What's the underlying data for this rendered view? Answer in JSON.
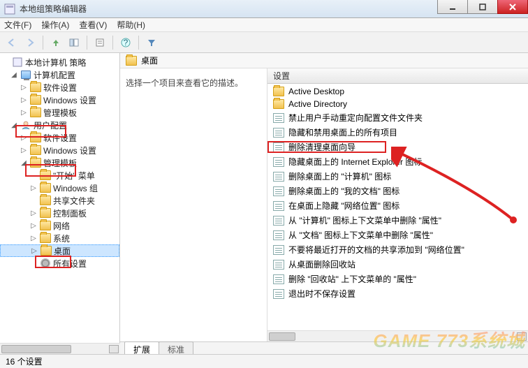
{
  "window": {
    "title": "本地组策略编辑器",
    "menus": [
      "文件(F)",
      "操作(A)",
      "查看(V)",
      "帮助(H)"
    ]
  },
  "tree": {
    "root": "本地计算机 策略",
    "computer": "计算机配置",
    "comp_children": [
      "软件设置",
      "Windows 设置",
      "管理模板"
    ],
    "user": "用户配置",
    "user_children": [
      "软件设置",
      "Windows 设置"
    ],
    "admin_templates": "管理模板",
    "admin_children": [
      "\"开始\" 菜单",
      "Windows 组",
      "共享文件夹",
      "控制面板",
      "网络",
      "系统",
      "桌面"
    ],
    "all_settings": "所有设置"
  },
  "content": {
    "header": "桌面",
    "description": "选择一个项目来查看它的描述。",
    "settings_header": "设置",
    "folders": [
      "Active Desktop",
      "Active Directory"
    ],
    "policies": [
      "禁止用户手动重定向配置文件文件夹",
      "隐藏和禁用桌面上的所有项目",
      "删除清理桌面向导",
      "隐藏桌面上的 Internet Explorer 图标",
      "删除桌面上的 \"计算机\" 图标",
      "删除桌面上的 \"我的文档\" 图标",
      "在桌面上隐藏 \"网络位置\" 图标",
      "从 \"计算机\" 图标上下文菜单中删除 \"属性\"",
      "从 \"文档\" 图标上下文菜单中删除 \"属性\"",
      "不要将最近打开的文档的共享添加到 \"网络位置\"",
      "从桌面删除回收站",
      "删除 \"回收站\" 上下文菜单的 \"属性\"",
      "退出时不保存设置"
    ]
  },
  "tabs": {
    "extended": "扩展",
    "standard": "标准"
  },
  "status": "16 个设置",
  "watermark": "GAME 773系统城"
}
